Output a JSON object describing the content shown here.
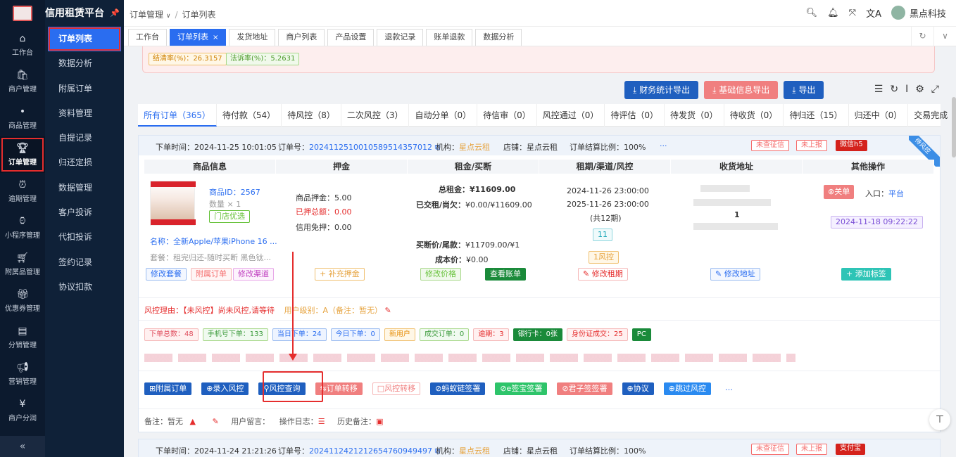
{
  "rail": [
    {
      "label": "工作台",
      "icon": "home-icon"
    },
    {
      "label": "商户管理",
      "icon": "bag-icon"
    },
    {
      "label": "商品管理",
      "icon": "apple-icon"
    },
    {
      "label": "订单管理",
      "icon": "trophy-icon",
      "active": true
    },
    {
      "label": "逾期管理",
      "icon": "alarm-icon"
    },
    {
      "label": "小程序管理",
      "icon": "watch-icon"
    },
    {
      "label": "附属品管理",
      "icon": "cart-icon"
    },
    {
      "label": "优惠券管理",
      "icon": "gift-icon"
    },
    {
      "label": "分销管理",
      "icon": "chart-icon"
    },
    {
      "label": "营销管理",
      "icon": "megaphone-icon"
    },
    {
      "label": "商户分润",
      "icon": "yen-icon"
    }
  ],
  "brand": "信用租赁平台",
  "submenu": [
    "订单列表",
    "数据分析",
    "附属订单",
    "资料管理",
    "自提记录",
    "归还定损",
    "数据管理",
    "客户投诉",
    "代扣投诉",
    "签约记录",
    "协议扣款"
  ],
  "header": {
    "crumb1": "订单管理",
    "crumb2": "订单列表",
    "user": "黑点科技"
  },
  "tabs": [
    "工作台",
    "订单列表",
    "发货地址",
    "商户列表",
    "产品设置",
    "退款记录",
    "账单退款",
    "数据分析"
  ],
  "stats": {
    "s1": "结清率(%)：",
    "v1": "26.3157",
    "s2": "法诉率(%)：",
    "v2": "5.2631"
  },
  "actions": {
    "finance_export": "财务统计导出",
    "basic_export": "基础信息导出",
    "export": "导出"
  },
  "status_tabs": [
    "所有订单（365）",
    "待付款（54）",
    "待风控（8）",
    "二次风控（3）",
    "自动分单（0）",
    "待信审（0）",
    "风控通过（0）",
    "待评估（0）",
    "待发货（0）",
    "待收货（0）",
    "待归还（15）",
    "归还中（0）",
    "交易完成"
  ],
  "order1": {
    "time": "下单时间：2024-11-25 10:01:05",
    "no_label": "订单号：",
    "no": "20241125100105895143570​12",
    "org_label": "机构：",
    "org": "星点云租",
    "shop": "店铺：星点云租",
    "ratio": "订单结算比例：100%",
    "badges": [
      "未查征信",
      "未上报",
      "微信h5"
    ],
    "ribbon": "待风控",
    "cols": [
      "商品信息",
      "押金",
      "租金/买断",
      "租期/渠道/风控",
      "收货地址",
      "其他操作"
    ],
    "prod_id": "商品ID：2567",
    "qty": "数量 × 1",
    "store_tag": "门店优选",
    "prod_name": "名称：全新Apple/苹果iPhone 16 ...",
    "pkg": "套餐：租完归还-随时买断 黑色钛...",
    "deposit": "商品押金：5.00",
    "paid_dep": "已押总额：0.00",
    "credit": "信用免押：0.00",
    "total_rent": "总租金：¥11609.00",
    "paid_owe_label": "已交租/尚欠：",
    "paid_owe": "¥0.00/¥11609.00",
    "buyout_label": "买断价/尾款：",
    "buyout": "¥11709.00/¥1",
    "cost_label": "成本价：",
    "cost": "¥0.00",
    "period1": "2024-11-26 23:00:00",
    "period2": "2025-11-26 23:00:00",
    "period3": "(共12期)",
    "tag11": "11",
    "risk1": "1风控",
    "addr_num": "1",
    "close": "⊗关单",
    "entry": "入口：平台",
    "entry_date": "2024-11-18 09:22:22",
    "btn_edit_pkg": "修改套餐",
    "btn_sub_order": "附属订单",
    "btn_channel": "修改渠道",
    "btn_supply": "+ 补充押金",
    "btn_price": "修改价格",
    "btn_bill": "查看账单",
    "btn_period": "修改租期",
    "btn_addr": "修改地址",
    "btn_tag": "+ 添加标签",
    "risk_reason": "风控理由：【未风控】尚未风控,请等待",
    "user_level": "用户级别：A（备注：暂无）",
    "counters": [
      "下单总数：48",
      "手机号下单：133",
      "当日下单：24",
      "今日下单：0",
      "新用户",
      "成交订单：0",
      "逾期：3",
      "银行卡：0张",
      "身份证成交：25",
      "PC"
    ],
    "ops": [
      "⊞附属订单",
      "⊕录入风控",
      "⚲风控查询",
      "⇆订单转移",
      "□风控转移",
      "⊘蚂蚁链签署",
      "⊘e签宝签署",
      "⊘君子签签署",
      "⊕协议",
      "⊕跳过风控",
      "…"
    ],
    "remark": "备注：暂无",
    "msg": "用户留言：",
    "log": "操作日志：",
    "hist": "历史备注："
  },
  "order2": {
    "time": "下单时间：2024-11-24 21:21:26",
    "no_label": "订单号：",
    "no": "20241124212126547609494​97",
    "org_label": "机构：",
    "org": "星点云租",
    "shop": "店铺：星点云租",
    "ratio": "订单结算比例：100%",
    "badges": [
      "未查征信",
      "未上报",
      "支付宝"
    ]
  },
  "colors": {
    "accent": "#2a6df0",
    "danger": "#e52d2d",
    "dark": "#0c1a2e"
  }
}
